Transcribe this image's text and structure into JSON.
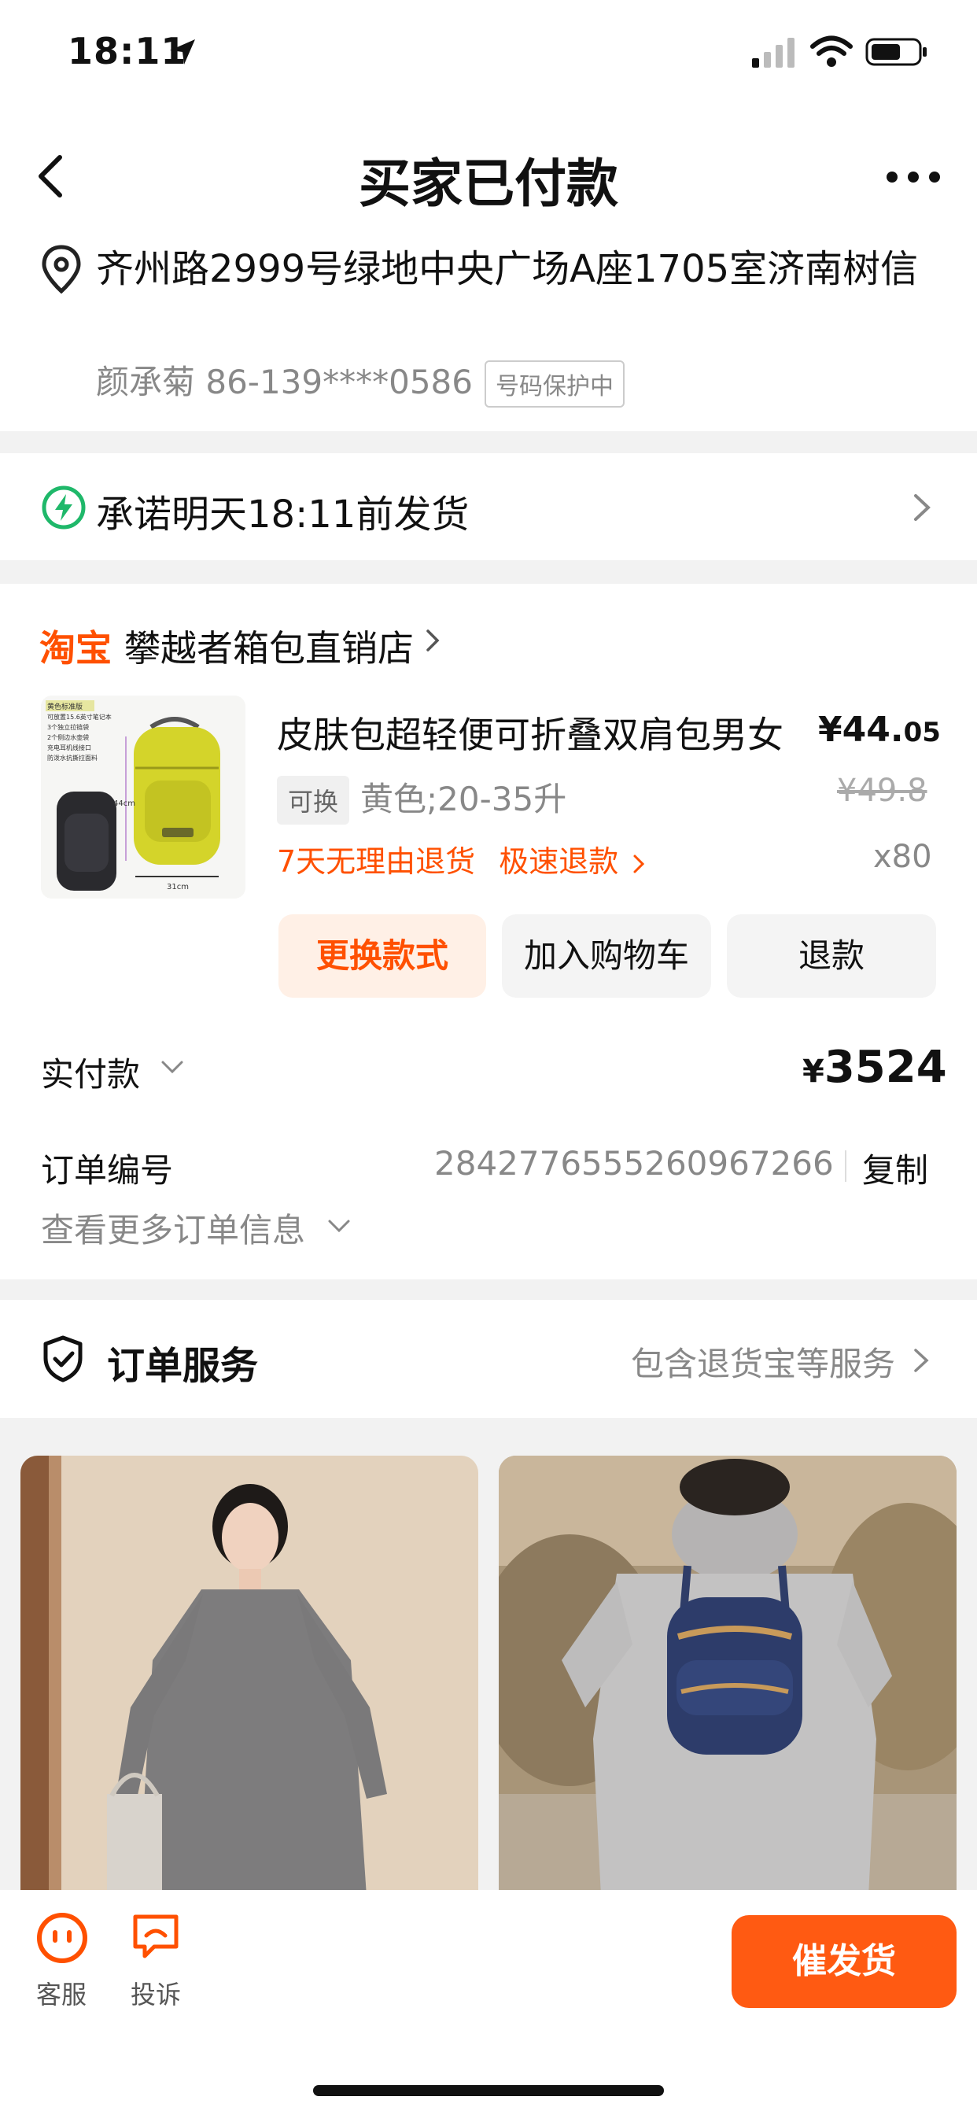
{
  "status_bar": {
    "time": "18:11"
  },
  "nav": {
    "title": "买家已付款"
  },
  "address": {
    "text": "齐州路2999号绿地中央广场A座1705室济南树信",
    "contact": "颜承菊 86-139****0586",
    "badge": "号码保护中"
  },
  "promise": {
    "text": "承诺明天18:11前发货"
  },
  "order": {
    "brand": "淘宝",
    "shop_name": "攀越者箱包直销店",
    "product": {
      "name": "皮肤包超轻便可折叠双肩包男女",
      "price_int": "¥44.",
      "price_dec": "05",
      "tag": "可换",
      "spec": "黄色;20-35升",
      "old_price": "¥49.8",
      "return_policy": "7天无理由退货",
      "fast_refund": "极速退款",
      "quantity": "x80",
      "image_labels": [
        "黄色标准版",
        "可放置15.6英寸笔记本",
        "3个独立拉链袋",
        "2个侧边水壶袋",
        "充电耳机线接口",
        "防泼水抗撕拉面料",
        "44cm",
        "31cm"
      ]
    },
    "buttons": {
      "change": "更换款式",
      "cart": "加入购物车",
      "refund": "退款"
    },
    "paid_label": "实付款",
    "paid_yen": "¥",
    "paid_amount": "3524",
    "order_no_label": "订单编号",
    "order_no": "2842776555260967266",
    "copy_label": "复制",
    "more_info": "查看更多订单信息"
  },
  "service": {
    "title": "订单服务",
    "desc": "包含退货宝等服务"
  },
  "bottom": {
    "service_label": "客服",
    "complaint_label": "投诉",
    "urge_button": "催发货"
  },
  "colors": {
    "accent": "#ff5000",
    "button_orange": "#ff5a12",
    "product_yellow": "#d4d42a"
  }
}
